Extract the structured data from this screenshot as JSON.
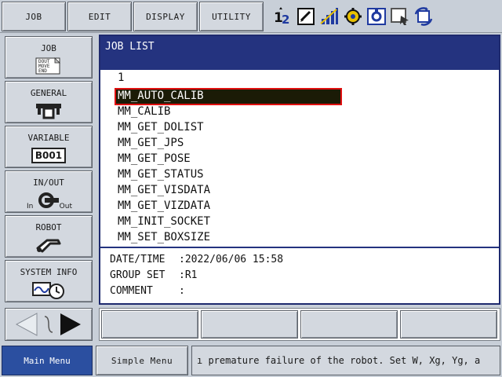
{
  "top_menu": {
    "job": "JOB",
    "edit": "EDIT",
    "display": "DISPLAY",
    "utility": "UTILITY"
  },
  "status_icons": [
    "axis-12-icon",
    "edit-page-icon",
    "signal-icon",
    "gear-mode-icon",
    "control-icon",
    "cursor-window-icon",
    "cycle-icon"
  ],
  "left_menu": [
    {
      "label": "JOB",
      "icon": "job-card-icon",
      "icon_text": "DOUT MOVE END"
    },
    {
      "label": "GENERAL",
      "icon": "general-icon"
    },
    {
      "label": "VARIABLE",
      "icon": "variable-icon",
      "icon_text": "B001"
    },
    {
      "label": "IN/OUT",
      "icon": "inout-icon",
      "in_text": "In",
      "out_text": "Out"
    },
    {
      "label": "ROBOT",
      "icon": "robot-icon"
    },
    {
      "label": "SYSTEM INFO",
      "icon": "system-info-icon"
    }
  ],
  "main": {
    "title": "JOB LIST",
    "page_indicator": "1",
    "jobs": [
      "MM_AUTO_CALIB",
      "MM_CALIB",
      "MM_GET_DOLIST",
      "MM_GET_JPS",
      "MM_GET_POSE",
      "MM_GET_STATUS",
      "MM_GET_VISDATA",
      "MM_GET_VIZDATA",
      "MM_INIT_SOCKET",
      "MM_SET_BOXSIZE"
    ],
    "selected_job_index": 0,
    "info": {
      "datetime_label": "DATE/TIME",
      "datetime_value": ":2022/06/06 15:58",
      "group_label": "GROUP SET",
      "group_value": ":R1",
      "comment_label": "COMMENT",
      "comment_value": ":"
    }
  },
  "bottom": {
    "main_menu": "Main Menu",
    "simple_menu": "Simple Menu",
    "message": "ı premature failure of the robot. Set W, Xg, Yg, a"
  },
  "colors": {
    "header_blue": "#24337f",
    "selection_border": "#e01010",
    "main_menu_blue": "#2b4fa0"
  }
}
